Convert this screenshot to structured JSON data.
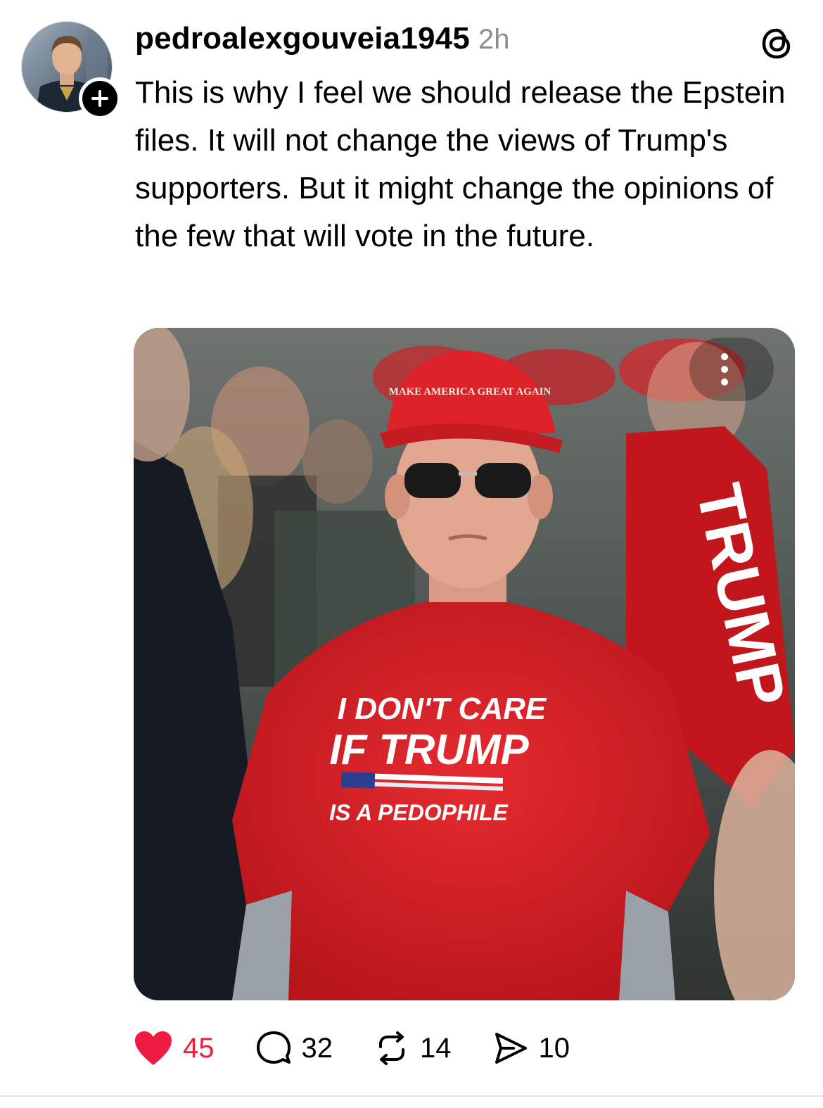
{
  "post": {
    "username": "pedroalexgouveia1945",
    "timestamp": "2h",
    "text": "This is why I feel we should release the Epstein files. It will not change the views of Trump's supporters. But it might change the opinions of the few that will vote in the future.",
    "media": {
      "hat_text": "MAKE AMERICA GREAT AGAIN",
      "shirt_line1": "I DON'T CARE",
      "shirt_line2": "IF TRUMP",
      "shirt_line3": "IS A PEDOPHILE",
      "flag_text": "TRUMP"
    },
    "actions": {
      "likes": "45",
      "comments": "32",
      "reposts": "14",
      "shares": "10"
    }
  },
  "colors": {
    "like": "#ed1c40",
    "timestamp": "#8e8e8e",
    "shirt_red": "#d91f26"
  },
  "icons": [
    "follow-plus-icon",
    "threads-logo-icon",
    "more-options-icon",
    "heart-icon",
    "comment-icon",
    "repost-icon",
    "share-icon"
  ]
}
